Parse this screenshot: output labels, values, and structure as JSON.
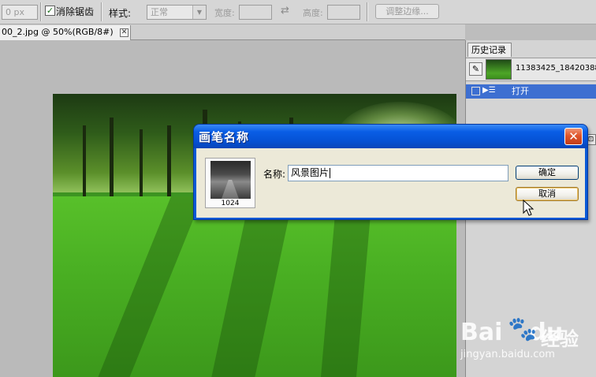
{
  "options_bar": {
    "feather_value": "0 px",
    "antialias_label": "消除锯齿",
    "antialias_checked": "✓",
    "style_label": "样式:",
    "style_value": "正常",
    "width_label": "宽度:",
    "swap_icon": "⇄",
    "height_label": "高度:",
    "refine_edge_label": "调整边缘..."
  },
  "document": {
    "tab_title": "00_2.jpg @ 50%(RGB/8#)",
    "close_glyph": "✕"
  },
  "history_panel": {
    "tab_label": "历史记录",
    "snapshot_label": "11383425_18420388",
    "open_step_label": "打开"
  },
  "dialog": {
    "title": "画笔名称",
    "close_glyph": "✕",
    "brush_size": "1024",
    "name_label": "名称:",
    "name_value": "风景图片",
    "ok_label": "确定",
    "cancel_label": "取消"
  },
  "watermark": {
    "brand": "Bai",
    "brand_suffix": "du",
    "product": "经验",
    "url": "jingyan.baidu.com"
  }
}
